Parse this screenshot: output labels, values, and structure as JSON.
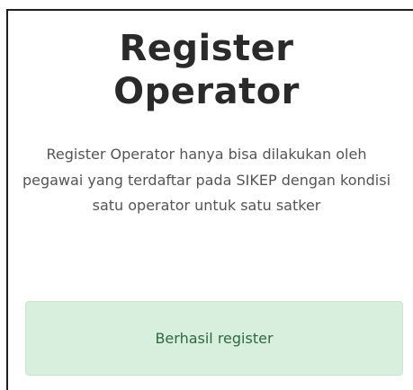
{
  "page": {
    "title": "Register\nOperator",
    "description": "Register Operator hanya bisa dilakukan oleh pegawai yang terdaftar pada SIKEP dengan kondisi satu operator untuk satu satker",
    "alert": {
      "message": "Berhasil register",
      "background_color": "#d8efdd",
      "text_color": "#2d6b3d"
    }
  }
}
